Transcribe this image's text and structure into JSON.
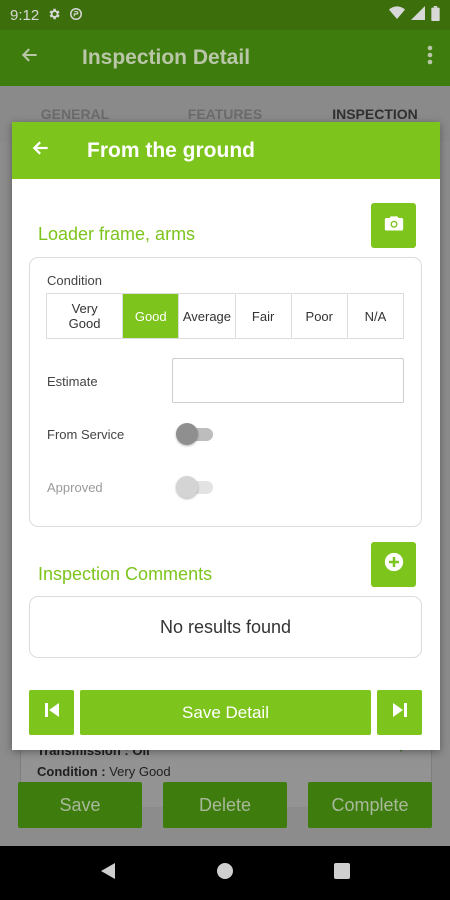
{
  "status_bar": {
    "time": "9:12"
  },
  "app_bar": {
    "title": "Inspection Detail"
  },
  "tabs": [
    {
      "label": "GENERAL"
    },
    {
      "label": "FEATURES"
    },
    {
      "label": "INSPECTION"
    }
  ],
  "background_item": {
    "line1": "Transmission : Oil",
    "condition_label": "Condition :",
    "condition_value": "Very Good"
  },
  "background_actions": {
    "save": "Save",
    "delete": "Delete",
    "complete": "Complete"
  },
  "dialog": {
    "title": "From the ground",
    "section_title": "Loader frame, arms",
    "condition_label": "Condition",
    "condition_options": [
      {
        "label": "Very Good",
        "selected": false
      },
      {
        "label": "Good",
        "selected": true
      },
      {
        "label": "Average",
        "selected": false
      },
      {
        "label": "Fair",
        "selected": false
      },
      {
        "label": "Poor",
        "selected": false
      },
      {
        "label": "N/A",
        "selected": false
      }
    ],
    "estimate_label": "Estimate",
    "estimate_value": "",
    "from_service_label": "From Service",
    "from_service_on": false,
    "approved_label": "Approved",
    "approved_on": false,
    "approved_enabled": false,
    "comments_title": "Inspection Comments",
    "no_results": "No results found",
    "save_detail": "Save Detail"
  },
  "icons": {
    "camera": "camera-icon",
    "add": "add-circle-icon",
    "first": "skip-previous-icon",
    "next": "skip-next-icon"
  },
  "colors": {
    "accent": "#7dc41c",
    "dim_app_bar": "#3f7c0e"
  }
}
